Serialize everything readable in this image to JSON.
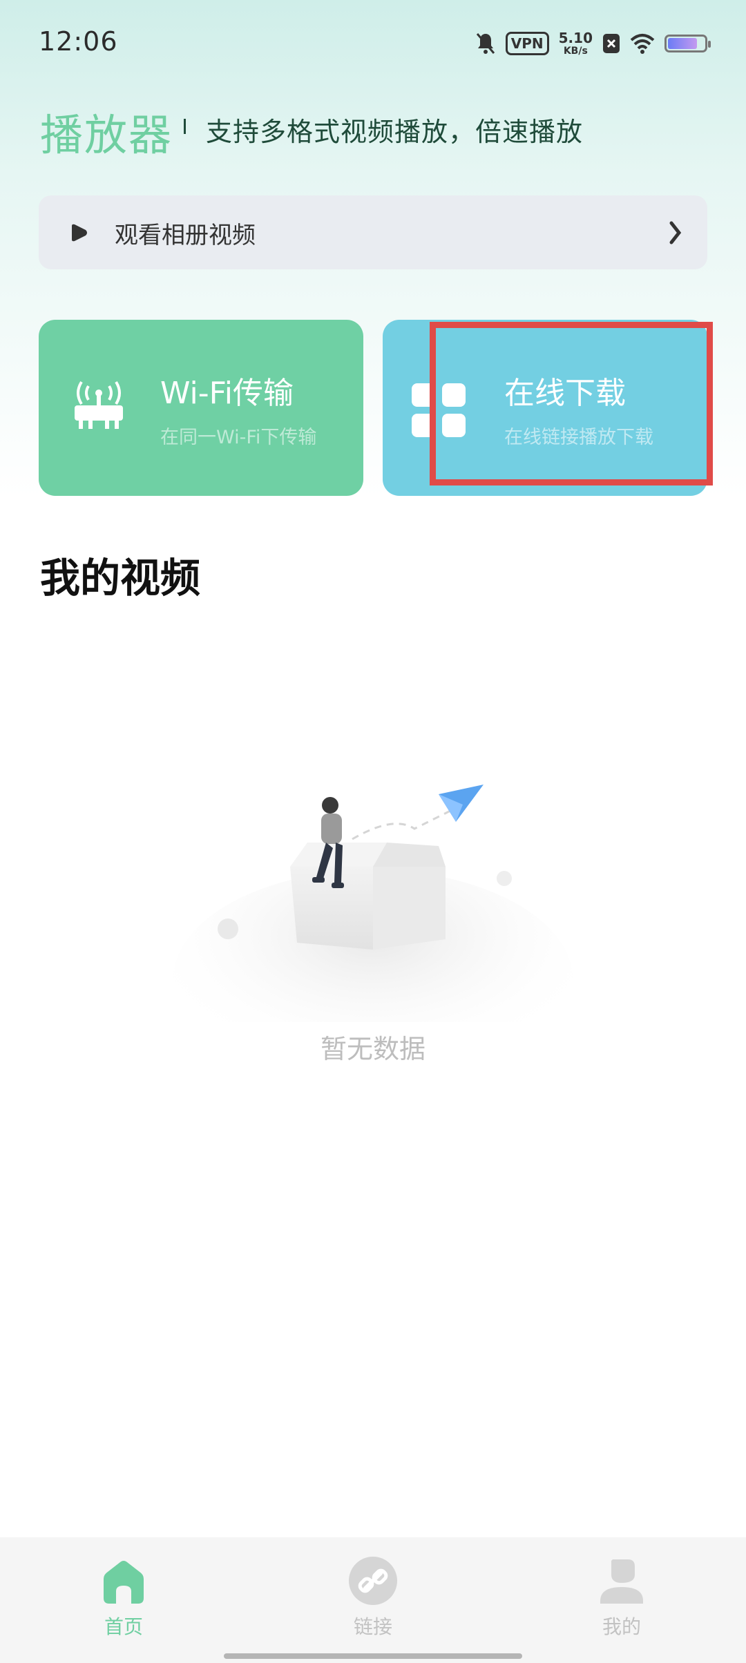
{
  "status_bar": {
    "time": "12:06",
    "vpn": "VPN",
    "speed_value": "5.10",
    "speed_unit": "KB/s",
    "icons": [
      "bell-muted-icon",
      "vpn-icon",
      "close-box-icon",
      "wifi-icon",
      "battery-icon"
    ]
  },
  "header": {
    "title": "播放器",
    "subtitle": "支持多格式视频播放，倍速播放"
  },
  "album_row": {
    "label": "观看相册视频",
    "chevron": "›"
  },
  "cards": [
    {
      "title": "Wi-Fi传输",
      "subtitle": "在同一Wi-Fi下传输",
      "icon": "router-icon",
      "color": "#6fd0a4"
    },
    {
      "title": "在线下载",
      "subtitle": "在线链接播放下载",
      "icon": "grid-icon",
      "color": "#73cfe2"
    }
  ],
  "section": {
    "title": "我的视频"
  },
  "empty_state": {
    "text": "暂无数据"
  },
  "bottom_nav": [
    {
      "label": "首页",
      "icon": "home-icon",
      "active": true
    },
    {
      "label": "链接",
      "icon": "link-icon",
      "active": false
    },
    {
      "label": "我的",
      "icon": "user-icon",
      "active": false
    }
  ],
  "colors": {
    "accent": "#6fcfa1",
    "wifi_card": "#6fd0a4",
    "download_card": "#73cfe2",
    "highlight": "#e04b48"
  }
}
